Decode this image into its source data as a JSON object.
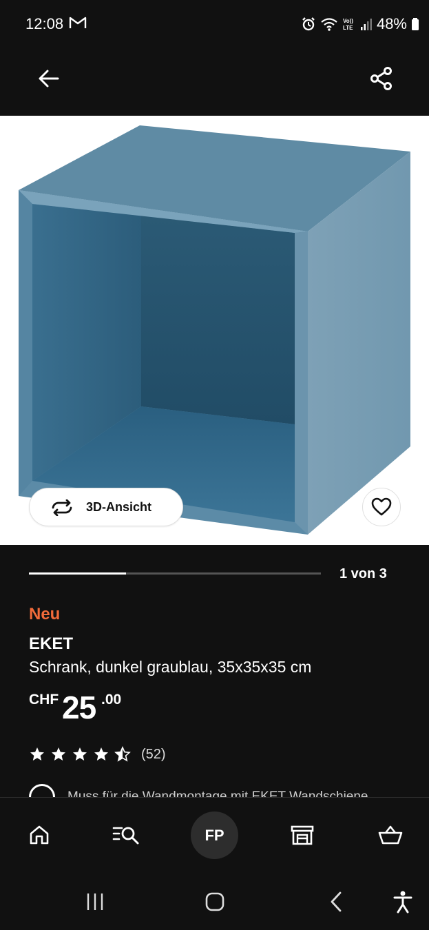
{
  "status_bar": {
    "time": "12:08",
    "battery": "48%",
    "icons": [
      "gmail-icon",
      "alarm-icon",
      "wifi-icon",
      "volte-icon",
      "signal-icon",
      "battery-icon"
    ]
  },
  "header": {
    "back_icon": "arrow-left-icon",
    "share_icon": "share-icon"
  },
  "gallery": {
    "view_3d_label": "3D-Ansicht",
    "favorite_icon": "heart-icon",
    "counter": "1 von 3",
    "progress_fraction": 0.333,
    "cube_colors": {
      "front": "#7a9db2",
      "top": "#6590a8",
      "inner": "#2f607c"
    }
  },
  "product": {
    "badge": "Neu",
    "name": "EKET",
    "description": "Schrank, dunkel graublau, 35x35x35 cm",
    "price": {
      "currency": "CHF",
      "integer": "25",
      "decimal": ".00"
    },
    "rating": {
      "value": 4.5,
      "max": 5,
      "count": "(52)"
    },
    "notice": "Muss für die Wandmontage mit EKET Wandschiene"
  },
  "bottom_nav": {
    "items": [
      {
        "icon": "home-icon"
      },
      {
        "icon": "search-list-icon"
      },
      {
        "label": "FP"
      },
      {
        "icon": "store-icon"
      },
      {
        "icon": "basket-icon"
      }
    ]
  },
  "system_nav": [
    "recent-apps-icon",
    "home-circle-icon",
    "back-chevron-icon",
    "accessibility-icon"
  ],
  "colors": {
    "background": "#111111",
    "badge_new": "#f26b3a",
    "image_bg": "#ffffff"
  }
}
